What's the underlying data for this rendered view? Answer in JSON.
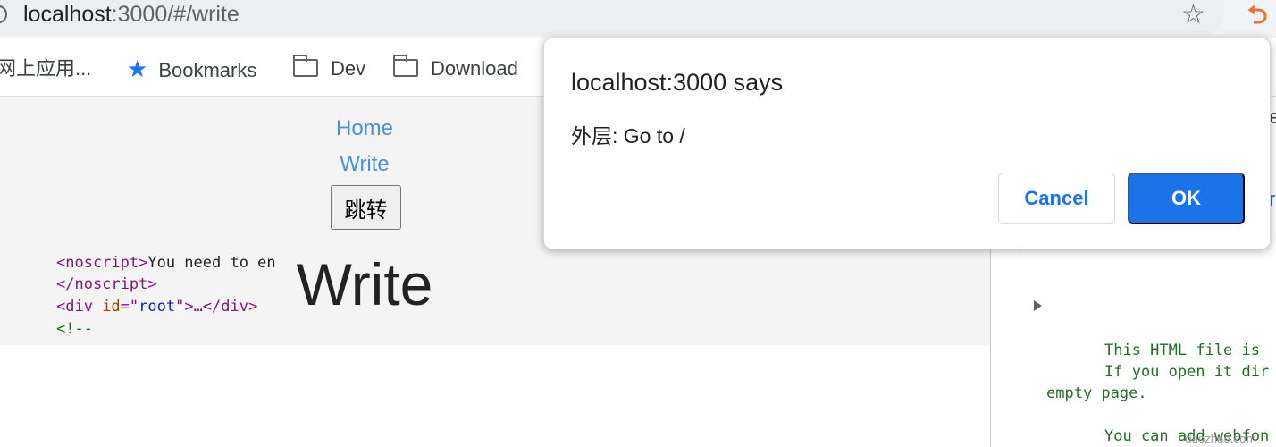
{
  "browser": {
    "url_host": "localhost",
    "url_rest": ":3000/#/write",
    "bookmarks": [
      {
        "label": "网上应用..."
      },
      {
        "label": "Bookmarks"
      },
      {
        "label": "Dev"
      },
      {
        "label": "Download"
      }
    ]
  },
  "page": {
    "nav_home": "Home",
    "nav_write": "Write",
    "jump_button": "跳转",
    "title": "Write"
  },
  "dialog": {
    "title": "localhost:3000 says",
    "message": "外层: Go to /",
    "cancel": "Cancel",
    "ok": "OK"
  },
  "devtools": {
    "noscript_open": "<noscript>",
    "noscript_text": "You need to en",
    "noscript_close": "</noscript>",
    "div_open": "<div ",
    "div_attr": "id",
    "div_eq": "=\"",
    "div_val": "root",
    "div_rest": "\">…</div>",
    "comment_open": "<!--",
    "comment_line1": "This HTML file is",
    "comment_line2": "If you open it dir",
    "comment_line3": "empty page.",
    "comment_line4": "You can add webfon",
    "edge_text_1": "e",
    "edge_text_2": "r"
  },
  "watermark": "daozhao.com",
  "colors": {
    "link": "#4a90d9",
    "accent": "#1a73e8",
    "tag": "#881280",
    "comment": "#236e25"
  }
}
